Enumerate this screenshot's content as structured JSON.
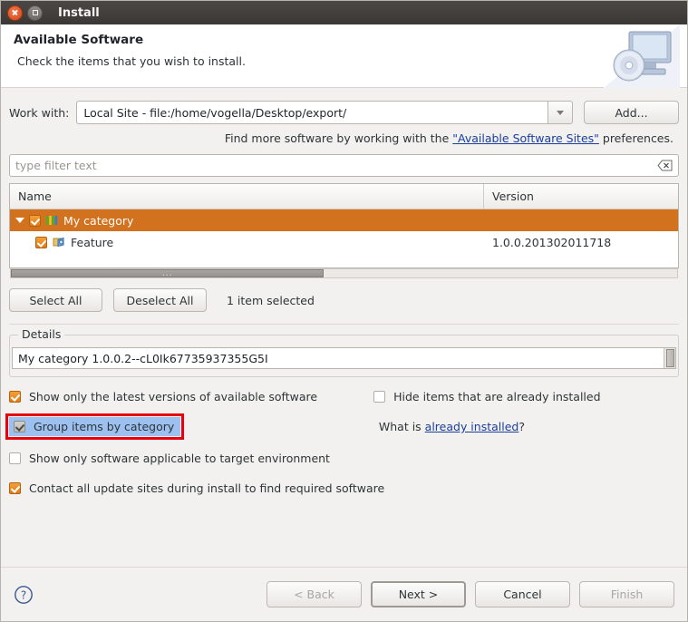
{
  "window": {
    "title": "Install",
    "close_icon": "close-icon",
    "maximize_icon": "maximize-icon"
  },
  "banner": {
    "heading": "Available Software",
    "subtitle": "Check the items that you wish to install.",
    "image_icon": "computer-disc-icon"
  },
  "work_with": {
    "label": "Work with:",
    "value": "Local Site - file:/home/vogella/Desktop/export/",
    "dropdown_icon": "chevron-down-icon",
    "add_label": "Add..."
  },
  "hint": {
    "prefix": "Find more software by working with the ",
    "link": "\"Available Software Sites\"",
    "suffix": " preferences."
  },
  "filter": {
    "placeholder": "type filter text",
    "value": "",
    "clear_icon": "clear-field-icon"
  },
  "table": {
    "columns": [
      "Name",
      "Version"
    ],
    "rows": [
      {
        "name": "My category",
        "version": "",
        "indent": 0,
        "checked": true,
        "selected": true,
        "expanded": true,
        "icon": "category-icon"
      },
      {
        "name": "Feature",
        "version": "1.0.0.201302011718",
        "indent": 1,
        "checked": true,
        "selected": false,
        "expanded": null,
        "icon": "feature-icon"
      }
    ],
    "scroll_grip": "..."
  },
  "selection": {
    "select_all": "Select All",
    "deselect_all": "Deselect All",
    "status": "1 item selected"
  },
  "details": {
    "group_label": "Details",
    "text": "My category 1.0.0.2--cL0Ik67735937355G5I"
  },
  "options": [
    {
      "label": "Show only the latest versions of available software",
      "checked": true,
      "style": "orange"
    },
    {
      "label": "Hide items that are already installed",
      "checked": false,
      "style": "empty"
    },
    {
      "label": "Group items by category",
      "checked": true,
      "style": "gray",
      "highlighted": true
    },
    {
      "label": "Show only software applicable to target environment",
      "checked": false,
      "style": "empty"
    },
    {
      "label": "Contact all update sites during install to find required software",
      "checked": true,
      "style": "orange"
    }
  ],
  "what_is": {
    "prefix": "What is ",
    "link": "already installed",
    "suffix": "?"
  },
  "footer": {
    "help_icon": "help-icon",
    "buttons": [
      {
        "label": "< Back",
        "enabled": false,
        "default": false
      },
      {
        "label": "Next >",
        "enabled": true,
        "default": true
      },
      {
        "label": "Cancel",
        "enabled": true,
        "default": false
      },
      {
        "label": "Finish",
        "enabled": false,
        "default": false
      }
    ]
  },
  "colors": {
    "selection_orange": "#d2721f",
    "highlight_blue": "#9cc0ef",
    "annotation_red": "#e8000d",
    "link_blue": "#1a3e9c"
  }
}
